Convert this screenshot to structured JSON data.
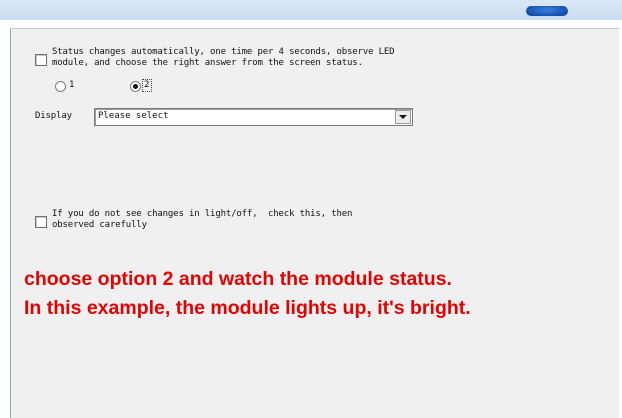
{
  "status_option": {
    "label_line1": "Status changes automatically, one time per 4 seconds, observe LED",
    "label_line2": "module, and choose the right answer from the screen status.",
    "checked": false,
    "radio_options": [
      "1",
      "2"
    ],
    "selected": "2"
  },
  "display": {
    "label": "Display",
    "selected_value": "Please select"
  },
  "lightoff_option": {
    "label_line1": "If you do not see changes in light/off,  check this, then",
    "label_line2": "observed carefully",
    "checked": false
  },
  "annotation": {
    "line1": "choose option 2 and watch the module status.",
    "line2": "In this example, the module lights up, it's bright.",
    "color": "#e10000"
  }
}
